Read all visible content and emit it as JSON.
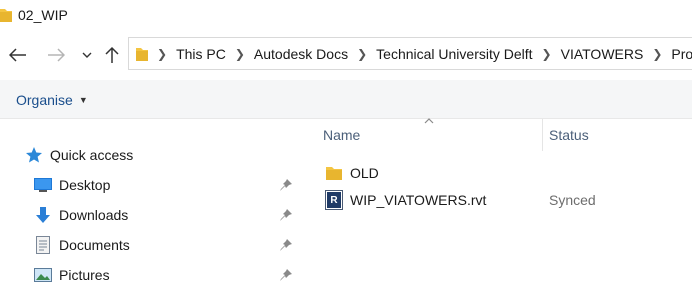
{
  "window": {
    "title": "02_WIP"
  },
  "nav": {
    "breadcrumb": [
      "This PC",
      "Autodesk Docs",
      "Technical University Delft",
      "VIATOWERS",
      "Proj"
    ]
  },
  "toolbar": {
    "organise_label": "Organise"
  },
  "sidebar": {
    "quick_access": "Quick access",
    "items": [
      {
        "label": "Desktop",
        "pinned": true
      },
      {
        "label": "Downloads",
        "pinned": true
      },
      {
        "label": "Documents",
        "pinned": true
      },
      {
        "label": "Pictures",
        "pinned": true
      }
    ]
  },
  "columns": {
    "name": "Name",
    "status": "Status"
  },
  "files": [
    {
      "name": "OLD",
      "type": "folder",
      "status": ""
    },
    {
      "name": "WIP_VIATOWERS.rvt",
      "type": "rvt",
      "status": "Synced"
    }
  ],
  "colors": {
    "accent": "#1a4e8c",
    "folder": "#f4c542",
    "command_bar": "#f5f6f7"
  }
}
